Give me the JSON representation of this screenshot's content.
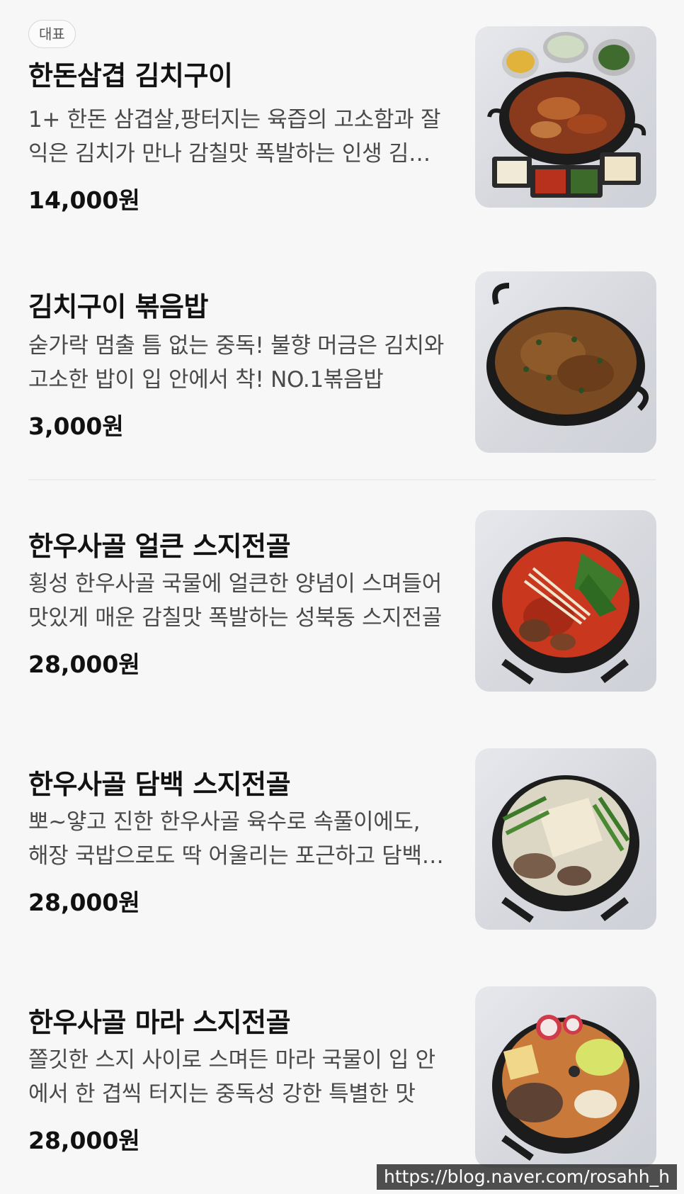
{
  "menu": {
    "items": [
      {
        "badge": "대표",
        "name": "한돈삼겹 김치구이",
        "description": "1+ 한돈 삼겹살,팡터지는 육즙의 고소함과 잘 익은 김치가 만나 감칠맛 폭발하는 인생 김치구이",
        "price": "14,000원",
        "image": "kimchi-pork-grill-photo"
      },
      {
        "name": "김치구이 볶음밥",
        "description": "숟가락 멈출 틈 없는 중독! 불향 머금은 김치와 고소한 밥이 입 안에서 착! NO.1볶음밥",
        "price": "3,000원",
        "image": "fried-rice-pan-photo"
      },
      {
        "name": "한우사골 얼큰 스지전골",
        "description": "횡성 한우사골 국물에 얼큰한 양념이 스며들어 맛있게 매운 감칠맛 폭발하는 성북동 스지전골",
        "price": "28,000원",
        "image": "spicy-suji-hotpot-photo"
      },
      {
        "name": "한우사골 담백 스지전골",
        "description": "뽀~얗고 진한 한우사골 육수로 속풀이에도, 해장 국밥으로도 딱 어울리는 포근하고 담백한 맛",
        "price": "28,000원",
        "image": "mild-suji-hotpot-photo"
      },
      {
        "name": "한우사골 마라 스지전골",
        "description": "쫄깃한 스지 사이로 스며든 마라 국물이 입 안에서 한 겹씩 터지는 중독성 강한 특별한 맛",
        "price": "28,000원",
        "image": "mala-suji-hotpot-photo"
      }
    ]
  },
  "watermark": "https://blog.naver.com/rosahh_h"
}
